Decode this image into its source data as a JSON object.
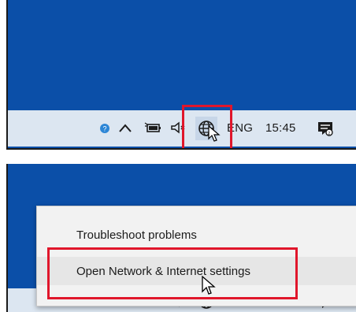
{
  "taskbar": {
    "language": "ENG",
    "time": "15:45"
  },
  "icons": {
    "help": "help-icon",
    "show_hidden": "chevron-up-icon",
    "battery": "battery-icon",
    "volume": "speaker-icon",
    "network": "globe-icon",
    "notifications": "action-center-icon"
  },
  "context_menu": {
    "items": [
      {
        "label": "Troubleshoot problems"
      },
      {
        "label": "Open Network & Internet settings"
      }
    ]
  },
  "colors": {
    "desktop": "#0b4fa8",
    "taskbar": "#dce6f1",
    "highlight": "#e0162b"
  }
}
